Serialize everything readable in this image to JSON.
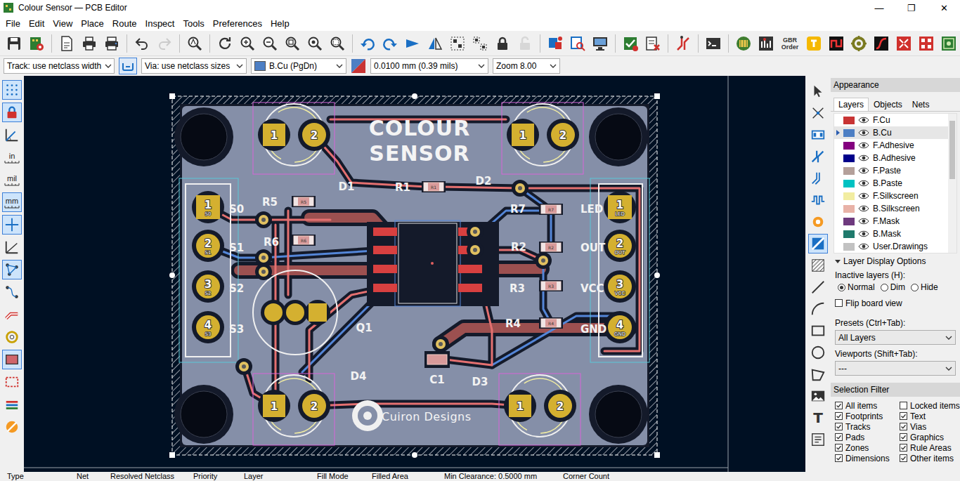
{
  "window": {
    "title": "Colour Sensor — PCB Editor",
    "controls": [
      "—",
      "❐",
      "✕"
    ]
  },
  "menu": [
    "File",
    "Edit",
    "View",
    "Place",
    "Route",
    "Inspect",
    "Tools",
    "Preferences",
    "Help"
  ],
  "main_toolbar": [
    {
      "kind": "save",
      "disabled": false
    },
    {
      "kind": "board-setup",
      "disabled": false
    },
    {
      "kind": "sep",
      "disabled": false
    },
    {
      "kind": "page",
      "disabled": false
    },
    {
      "kind": "print",
      "disabled": false
    },
    {
      "kind": "plot",
      "disabled": false
    },
    {
      "kind": "sep",
      "disabled": false
    },
    {
      "kind": "undo",
      "disabled": false
    },
    {
      "kind": "redo",
      "disabled": true
    },
    {
      "kind": "sep",
      "disabled": false
    },
    {
      "kind": "find",
      "disabled": false
    },
    {
      "kind": "sep",
      "disabled": false
    },
    {
      "kind": "refresh",
      "disabled": false
    },
    {
      "kind": "zoom-in",
      "disabled": false
    },
    {
      "kind": "zoom-out",
      "disabled": false
    },
    {
      "kind": "zoom-fit",
      "disabled": false
    },
    {
      "kind": "zoom-objects",
      "disabled": false
    },
    {
      "kind": "zoom-select",
      "disabled": false
    },
    {
      "kind": "sep",
      "disabled": false
    },
    {
      "kind": "rotate-ccw",
      "disabled": false
    },
    {
      "kind": "rotate-cw",
      "disabled": false
    },
    {
      "kind": "flip",
      "disabled": false
    },
    {
      "kind": "mirror",
      "disabled": false
    },
    {
      "kind": "group",
      "disabled": false
    },
    {
      "kind": "ungroup",
      "disabled": false
    },
    {
      "kind": "lock",
      "disabled": false
    },
    {
      "kind": "unlock",
      "disabled": true
    },
    {
      "kind": "sep",
      "disabled": false
    },
    {
      "kind": "netlist",
      "disabled": false
    },
    {
      "kind": "footprint-check",
      "disabled": false
    },
    {
      "kind": "viewer-3d",
      "disabled": false
    },
    {
      "kind": "sep",
      "disabled": false
    },
    {
      "kind": "drc",
      "disabled": false
    },
    {
      "kind": "checklist",
      "disabled": false
    },
    {
      "kind": "sep",
      "disabled": false
    },
    {
      "kind": "track",
      "disabled": false
    },
    {
      "kind": "sep",
      "disabled": false
    },
    {
      "kind": "console",
      "disabled": false
    },
    {
      "kind": "sep",
      "disabled": false
    },
    {
      "kind": "plugin-board",
      "disabled": false
    },
    {
      "kind": "plugin-stats",
      "disabled": false
    },
    {
      "kind": "gbr",
      "label": "GBR",
      "sub": "Order",
      "disabled": false
    },
    {
      "kind": "plugin-yellow",
      "disabled": false
    },
    {
      "kind": "plugin-squiggle",
      "disabled": false
    },
    {
      "kind": "plugin-circle",
      "disabled": false
    },
    {
      "kind": "plugin-curve",
      "disabled": false
    },
    {
      "kind": "plugin-arrows",
      "disabled": false
    },
    {
      "kind": "plugin-squares",
      "disabled": false
    },
    {
      "kind": "plugin-rf",
      "disabled": false
    }
  ],
  "options_bar": {
    "track": "Track: use netclass width",
    "auto_width": {
      "selected": true
    },
    "via": "Via: use netclass sizes",
    "layer": "B.Cu (PgDn)",
    "grid": "0.0100 mm (0.39 mils)",
    "zoom": "Zoom 8.00"
  },
  "left_toolbar": [
    {
      "kind": "grid",
      "selected": true
    },
    {
      "kind": "lock-red",
      "selected": true
    },
    {
      "kind": "polar",
      "selected": false
    },
    {
      "kind": "unit",
      "label": "in",
      "selected": false
    },
    {
      "kind": "unit",
      "label": "mil",
      "selected": false
    },
    {
      "kind": "unit",
      "label": "mm",
      "selected": true
    },
    {
      "kind": "cursor",
      "selected": true
    },
    {
      "kind": "angle",
      "selected": false
    },
    {
      "kind": "ratsnest",
      "selected": true
    },
    {
      "kind": "ratsnest-curve",
      "selected": false
    },
    {
      "kind": "tracks-outline",
      "selected": false
    },
    {
      "kind": "vias-outline",
      "selected": false
    },
    {
      "kind": "zones",
      "selected": true
    },
    {
      "kind": "zone-outline",
      "selected": false
    },
    {
      "kind": "net-colors",
      "selected": false
    },
    {
      "kind": "highcontrast",
      "selected": false
    }
  ],
  "right_toolbar": [
    {
      "kind": "select",
      "selected": false
    },
    {
      "kind": "local-ratsnest",
      "selected": false
    },
    {
      "kind": "footprint",
      "selected": false
    },
    {
      "kind": "route",
      "selected": false
    },
    {
      "kind": "diff-pair",
      "selected": false
    },
    {
      "kind": "tune",
      "selected": false
    },
    {
      "kind": "via",
      "selected": false
    },
    {
      "kind": "zone",
      "selected": true
    },
    {
      "kind": "rule-area",
      "selected": false
    },
    {
      "kind": "line",
      "selected": false
    },
    {
      "kind": "arc",
      "selected": false
    },
    {
      "kind": "rect",
      "selected": false
    },
    {
      "kind": "circle",
      "selected": false
    },
    {
      "kind": "polygon",
      "selected": false
    },
    {
      "kind": "image",
      "selected": false
    },
    {
      "kind": "text",
      "label": "T",
      "selected": false
    },
    {
      "kind": "textbox",
      "selected": false
    }
  ],
  "board": {
    "title": [
      "COLOUR",
      "SENSOR"
    ],
    "logo_text": "Cuiron Designs",
    "leds": [
      {
        "ref": "D1",
        "pins": [
          {
            "num": "1",
            "kind": "square"
          },
          {
            "num": "2",
            "kind": "round"
          }
        ]
      },
      {
        "ref": "D2",
        "pins": [
          {
            "num": "1",
            "kind": "square"
          },
          {
            "num": "2",
            "kind": "round"
          }
        ]
      },
      {
        "ref": "D3",
        "pins": [
          {
            "num": "1",
            "kind": "square"
          },
          {
            "num": "2",
            "kind": "round"
          }
        ]
      },
      {
        "ref": "D4",
        "pins": [
          {
            "num": "1",
            "kind": "square"
          },
          {
            "num": "2",
            "kind": "round"
          }
        ]
      }
    ],
    "connectors": [
      {
        "pins": [
          {
            "num": "1",
            "net": "S0",
            "label": "S0",
            "kind": "square"
          },
          {
            "num": "2",
            "net": "S1",
            "label": "S1",
            "kind": "round"
          },
          {
            "num": "3",
            "net": "S2",
            "label": "S2",
            "kind": "round"
          },
          {
            "num": "4",
            "net": "S3",
            "label": "S3",
            "kind": "round"
          }
        ]
      },
      {
        "pins": [
          {
            "num": "1",
            "net": "LED",
            "label": "LED",
            "kind": "square"
          },
          {
            "num": "2",
            "net": "OUT",
            "label": "OUT",
            "kind": "round"
          },
          {
            "num": "3",
            "net": "VCC",
            "label": "VCC",
            "kind": "round"
          },
          {
            "num": "4",
            "net": "GND",
            "label": "GND",
            "kind": "round"
          }
        ]
      }
    ],
    "resistors": [
      {
        "ref": "R5"
      },
      {
        "ref": "R6"
      },
      {
        "ref": "R1"
      },
      {
        "ref": "R7"
      },
      {
        "ref": "R2"
      },
      {
        "ref": "R3"
      },
      {
        "ref": "R4"
      }
    ],
    "transistor": {
      "ref": "Q1",
      "pins": [
        {
          "kind": "round"
        },
        {
          "kind": "round"
        },
        {
          "kind": "square"
        }
      ]
    },
    "capacitor": {
      "ref": "C1"
    }
  },
  "appearance": {
    "title": "Appearance",
    "tabs": [
      {
        "label": "Layers",
        "selected": true
      },
      {
        "label": "Objects",
        "selected": false
      },
      {
        "label": "Nets",
        "selected": false
      }
    ],
    "layers": [
      {
        "name": "F.Cu",
        "color": "#c83434",
        "visible": true,
        "selected": false
      },
      {
        "name": "B.Cu",
        "color": "#4d7fc4",
        "visible": true,
        "selected": true
      },
      {
        "name": "F.Adhesive",
        "color": "#84007f",
        "visible": true,
        "selected": false
      },
      {
        "name": "B.Adhesive",
        "color": "#00008a",
        "visible": true,
        "selected": false
      },
      {
        "name": "F.Paste",
        "color": "#b4a09a",
        "visible": true,
        "selected": false
      },
      {
        "name": "B.Paste",
        "color": "#00c2c2",
        "visible": true,
        "selected": false
      },
      {
        "name": "F.Silkscreen",
        "color": "#f2eda1",
        "visible": true,
        "selected": false
      },
      {
        "name": "B.Silkscreen",
        "color": "#e8b2a7",
        "visible": true,
        "selected": false
      },
      {
        "name": "F.Mask",
        "color": "#6e3a7e",
        "visible": true,
        "selected": false
      },
      {
        "name": "B.Mask",
        "color": "#1f7a6c",
        "visible": true,
        "selected": false
      },
      {
        "name": "User.Drawings",
        "color": "#c2c2c2",
        "visible": true,
        "selected": false
      }
    ],
    "list_scroll": {
      "level": 0.42
    },
    "display_options": {
      "label": "Layer Display Options",
      "expanded": true,
      "inactive_label": "Inactive layers (H):",
      "modes": [
        {
          "label": "Normal",
          "selected": true
        },
        {
          "label": "Dim",
          "selected": false
        },
        {
          "label": "Hide",
          "selected": false
        }
      ],
      "flip": {
        "label": "Flip board view",
        "checked": false
      }
    },
    "presets": {
      "label": "Presets (Ctrl+Tab):",
      "value": "All Layers"
    },
    "viewports": {
      "label": "Viewports (Shift+Tab):",
      "value": "---"
    }
  },
  "selection_filter": {
    "title": "Selection Filter",
    "items": [
      {
        "label": "All items",
        "checked": true
      },
      {
        "label": "Locked items",
        "checked": false
      },
      {
        "label": "Footprints",
        "checked": true
      },
      {
        "label": "Text",
        "checked": true
      },
      {
        "label": "Tracks",
        "checked": true
      },
      {
        "label": "Vias",
        "checked": true
      },
      {
        "label": "Pads",
        "checked": true
      },
      {
        "label": "Graphics",
        "checked": true
      },
      {
        "label": "Zones",
        "checked": true
      },
      {
        "label": "Rule Areas",
        "checked": true
      },
      {
        "label": "Dimensions",
        "checked": true
      },
      {
        "label": "Other items",
        "checked": true
      }
    ]
  },
  "status_bar": {
    "columns": [
      "Type",
      "Net",
      "Resolved Netclass",
      "Priority",
      "Layer",
      "Fill Mode",
      "Filled Area",
      "Min Clearance: 0.5000 mm",
      "Corner Count"
    ]
  }
}
